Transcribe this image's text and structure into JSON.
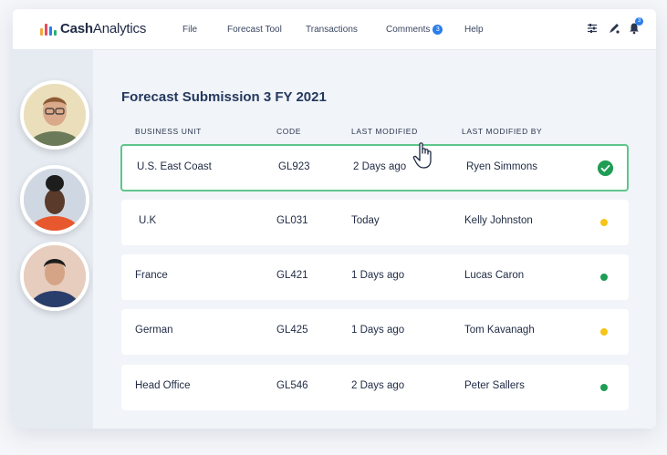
{
  "app": {
    "logo_cash": "Cash",
    "logo_analytics": "Analytics",
    "logo_bar_colors": [
      "#f2a93b",
      "#e84a5f",
      "#2b7de9",
      "#29b36f"
    ]
  },
  "nav": {
    "file": "File",
    "forecast_tool": "Forecast Tool",
    "transactions": "Transactions",
    "comments": "Comments",
    "comments_count": "3",
    "help": "Help"
  },
  "top_icons": {
    "filter": "sliders-icon",
    "edit": "pen-icon",
    "bell": "bell-icon",
    "bell_count": "3"
  },
  "page": {
    "title": "Forecast Submission 3 FY 2021"
  },
  "table": {
    "headers": [
      "BUSINESS UNIT",
      "CODE",
      "LAST MODIFIED",
      "LAST MODIFIED BY"
    ],
    "rows": [
      {
        "unit": "U.S. East Coast",
        "code": "GL923",
        "modified": "2 Days ago",
        "by": "Ryen Simmons",
        "status": "approved"
      },
      {
        "unit": "U.K",
        "code": "GL031",
        "modified": "Today",
        "by": "Kelly Johnston",
        "status": "pending"
      },
      {
        "unit": "France",
        "code": "GL421",
        "modified": "1 Days ago",
        "by": "Lucas Caron",
        "status": "complete"
      },
      {
        "unit": "German",
        "code": "GL425",
        "modified": "1 Days ago",
        "by": "Tom Kavanagh",
        "status": "pending"
      },
      {
        "unit": "Head Office",
        "code": "GL546",
        "modified": "2 Days ago",
        "by": "Peter Sallers",
        "status": "complete"
      }
    ]
  },
  "colors": {
    "accent": "#2b7de9",
    "title": "#24385f",
    "status_green": "#1f9d55",
    "status_yellow": "#f5c518",
    "selected_border": "#5fc68a"
  }
}
